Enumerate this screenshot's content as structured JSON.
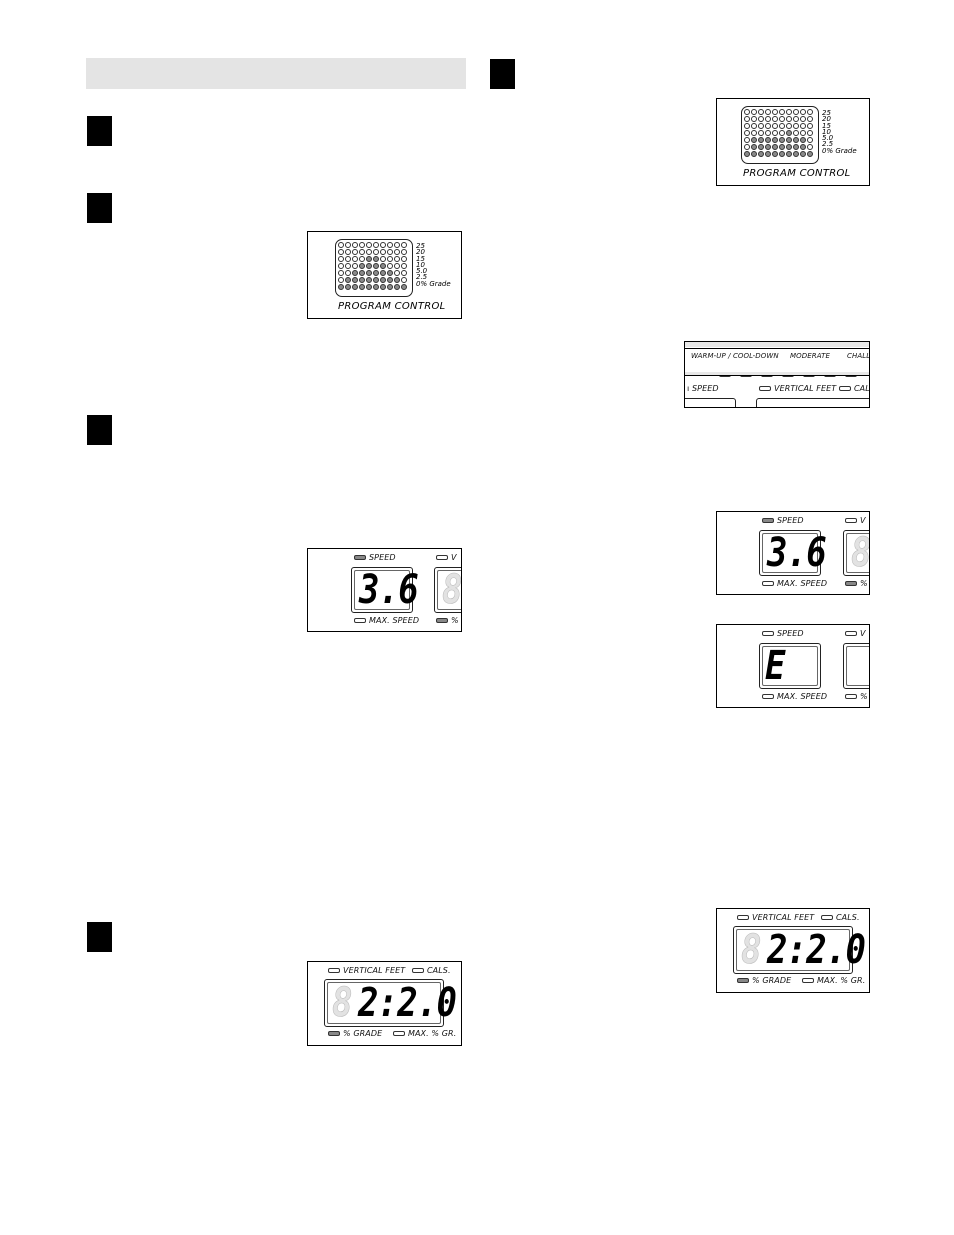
{
  "page": {
    "header_bar": "",
    "steps": [
      {
        "id": "step-1",
        "column": "left"
      },
      {
        "id": "step-2",
        "column": "left"
      },
      {
        "id": "step-3",
        "column": "left"
      },
      {
        "id": "step-4",
        "column": "left"
      },
      {
        "id": "step-5",
        "column": "right"
      }
    ]
  },
  "program_control_left": {
    "title": "PROGRAM CONTROL",
    "grade_labels": [
      "25",
      "20",
      "15",
      "10",
      "5.0",
      "2.5",
      "0% Grade"
    ],
    "columns": 10,
    "rows": 7,
    "column_heights": [
      1,
      2,
      3,
      4,
      5,
      5,
      4,
      3,
      2,
      1
    ]
  },
  "program_control_right": {
    "title": "PROGRAM CONTROL",
    "grade_labels": [
      "25",
      "20",
      "15",
      "10",
      "5.0",
      "2.5",
      "0% Grade"
    ],
    "columns": 10,
    "rows": 7,
    "column_heights": [
      1,
      3,
      3,
      3,
      3,
      3,
      4,
      3,
      3,
      1
    ]
  },
  "intensity_strip": {
    "labels": [
      "WARM-UP / COOL-DOWN",
      "MODERATE",
      "CHALL"
    ],
    "leds": [
      "on",
      "on",
      "on",
      "mid",
      "mid",
      "mid",
      "off"
    ],
    "bottom_labels": {
      "speed": "SPEED",
      "vertical_feet": "VERTICAL FEET",
      "cals": "CAL"
    }
  },
  "speed_display_left": {
    "top_label": "SPEED",
    "top_led": "on",
    "value": "3.6",
    "bottom_label": "MAX. SPEED",
    "bottom_led": "off",
    "side_top_label": "V",
    "side_bottom_label": "%",
    "side_bottom_led": "on"
  },
  "speed_display_right": {
    "top_label": "SPEED",
    "top_led": "on",
    "value": "3.6",
    "bottom_label": "MAX. SPEED",
    "bottom_led": "off",
    "side_top_label": "V",
    "side_bottom_label": "%",
    "side_bottom_led": "on"
  },
  "error_display": {
    "top_label": "SPEED",
    "top_led": "off",
    "value": "E",
    "bottom_label": "MAX. SPEED",
    "bottom_led": "off",
    "side_top_label": "V",
    "side_bottom_label": "%",
    "side_bottom_led": "off"
  },
  "grade_display_left": {
    "top_labels": [
      "VERTICAL FEET",
      "CALS."
    ],
    "value": "2:2.0",
    "bottom_labels": [
      "% GRADE",
      "MAX. % GR."
    ],
    "bottom_leds": [
      "on",
      "off"
    ]
  },
  "grade_display_right": {
    "top_labels": [
      "VERTICAL FEET",
      "CALS."
    ],
    "value": "2:2.0",
    "bottom_labels": [
      "% GRADE",
      "MAX. % GR."
    ],
    "bottom_leds": [
      "on",
      "off"
    ]
  }
}
